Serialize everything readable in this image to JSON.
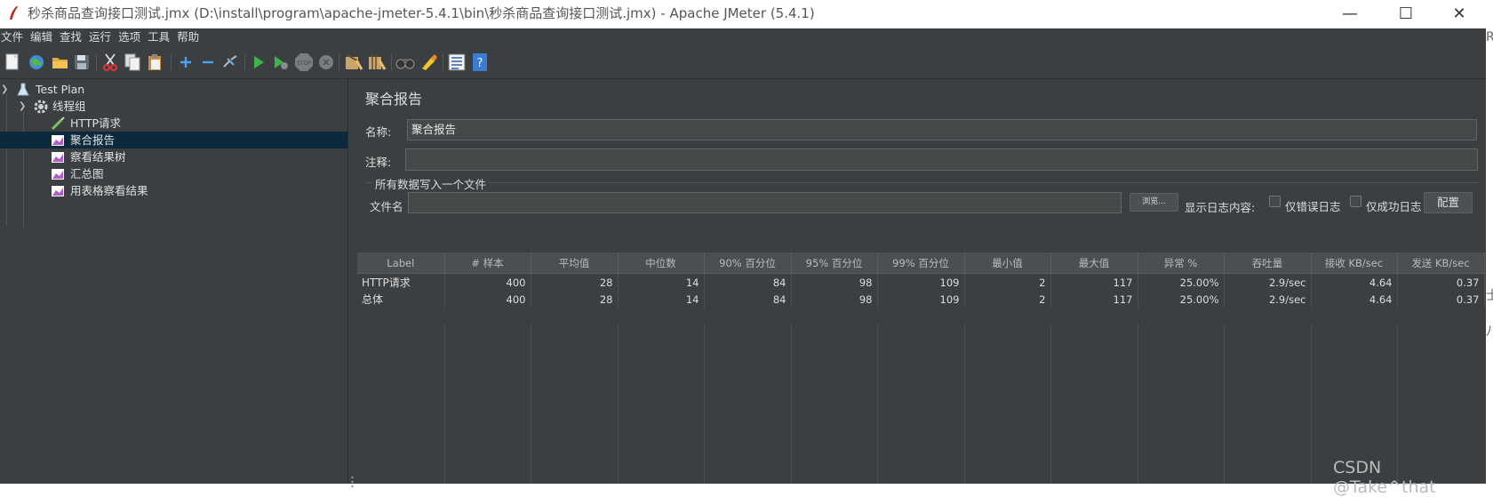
{
  "window": {
    "title": "秒杀商品查询接口测试.jmx (D:\\install\\program\\apache-jmeter-5.4.1\\bin\\秒杀商品查询接口测试.jmx) - Apache JMeter (5.4.1)",
    "minimize": "—",
    "maximize": "☐",
    "close": "✕"
  },
  "menu": [
    "文件",
    "编辑",
    "查找",
    "运行",
    "选项",
    "工具",
    "帮助"
  ],
  "tree": {
    "test_plan": "Test Plan",
    "thread_group": "线程组",
    "items": [
      "HTTP请求",
      "聚合报告",
      "察看结果树",
      "汇总图",
      "用表格察看结果"
    ]
  },
  "panel": {
    "title": "聚合报告",
    "name_label": "名称:",
    "name_value": "聚合报告",
    "comment_label": "注释:",
    "comment_value": "",
    "file_section": "所有数据写入一个文件",
    "filename_label": "文件名",
    "filename_value": "",
    "browse_button": "浏览...",
    "log_display_label": "显示日志内容:",
    "errors_only": "仅错误日志",
    "successes_only": "仅成功日志",
    "configure_button": "配置"
  },
  "table": {
    "headers": [
      "Label",
      "# 样本",
      "平均值",
      "中位数",
      "90% 百分位",
      "95% 百分位",
      "99% 百分位",
      "最小值",
      "最大值",
      "异常 %",
      "吞吐量",
      "接收 KB/sec",
      "发送 KB/sec"
    ],
    "rows": [
      [
        "HTTP请求",
        "400",
        "28",
        "14",
        "84",
        "98",
        "109",
        "2",
        "117",
        "25.00%",
        "2.9/sec",
        "4.64",
        "0.37"
      ],
      [
        "总体",
        "400",
        "28",
        "14",
        "84",
        "98",
        "109",
        "2",
        "117",
        "25.00%",
        "2.9/sec",
        "4.64",
        "0.37"
      ]
    ]
  },
  "watermark": "CSDN @Take^that",
  "edge_clip": [
    "R",
    "士",
    "八"
  ]
}
